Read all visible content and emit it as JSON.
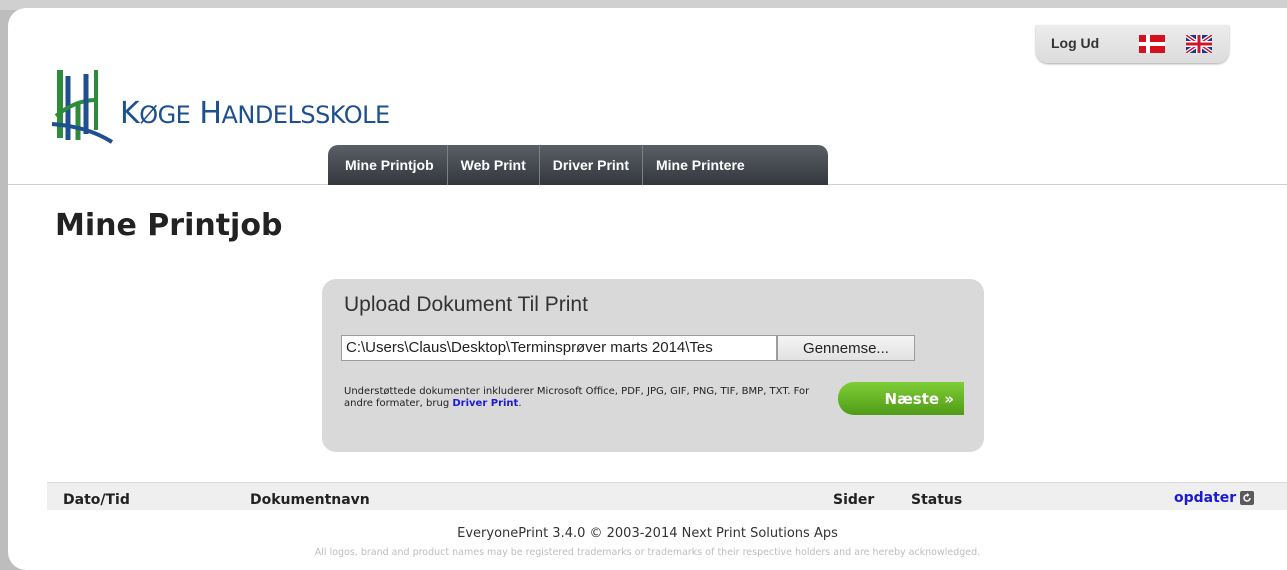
{
  "header": {
    "logout_label": "Log Ud",
    "logo_text_first_big": "K",
    "logo_text_first_small": "ØGE",
    "logo_text_second_big": "H",
    "logo_text_second_small": "ANDELSSKOLE",
    "colors": {
      "logo_blue": "#1e4f8e",
      "logo_green": "#2e8b3a"
    }
  },
  "nav": {
    "items": [
      {
        "label": "Mine Printjob"
      },
      {
        "label": "Web Print"
      },
      {
        "label": "Driver Print"
      },
      {
        "label": "Mine Printere"
      }
    ]
  },
  "main": {
    "page_title": "Mine Printjob",
    "upload": {
      "title": "Upload Dokument Til Print",
      "file_value": "C:\\Users\\Claus\\Desktop\\Terminsprøver marts 2014\\Tes",
      "browse_label": "Gennemse...",
      "support_text": "Understøttede dokumenter inkluderer Microsoft Office, PDF, JPG, GIF, PNG, TIF, BMP, TXT. For andre formater, brug",
      "support_link": "Driver Print",
      "support_end": ".",
      "next_label": "Næste »"
    },
    "table": {
      "columns": [
        "Dato/Tid",
        "Dokumentnavn",
        "Sider",
        "Status"
      ],
      "refresh_label": "opdater"
    }
  },
  "footer": {
    "main": "EveryonePrint 3.4.0 © 2003-2014 Next Print Solutions Aps",
    "note": "All logos, brand and product names may be registered trademarks or trademarks of their respective holders and are hereby acknowledged."
  }
}
